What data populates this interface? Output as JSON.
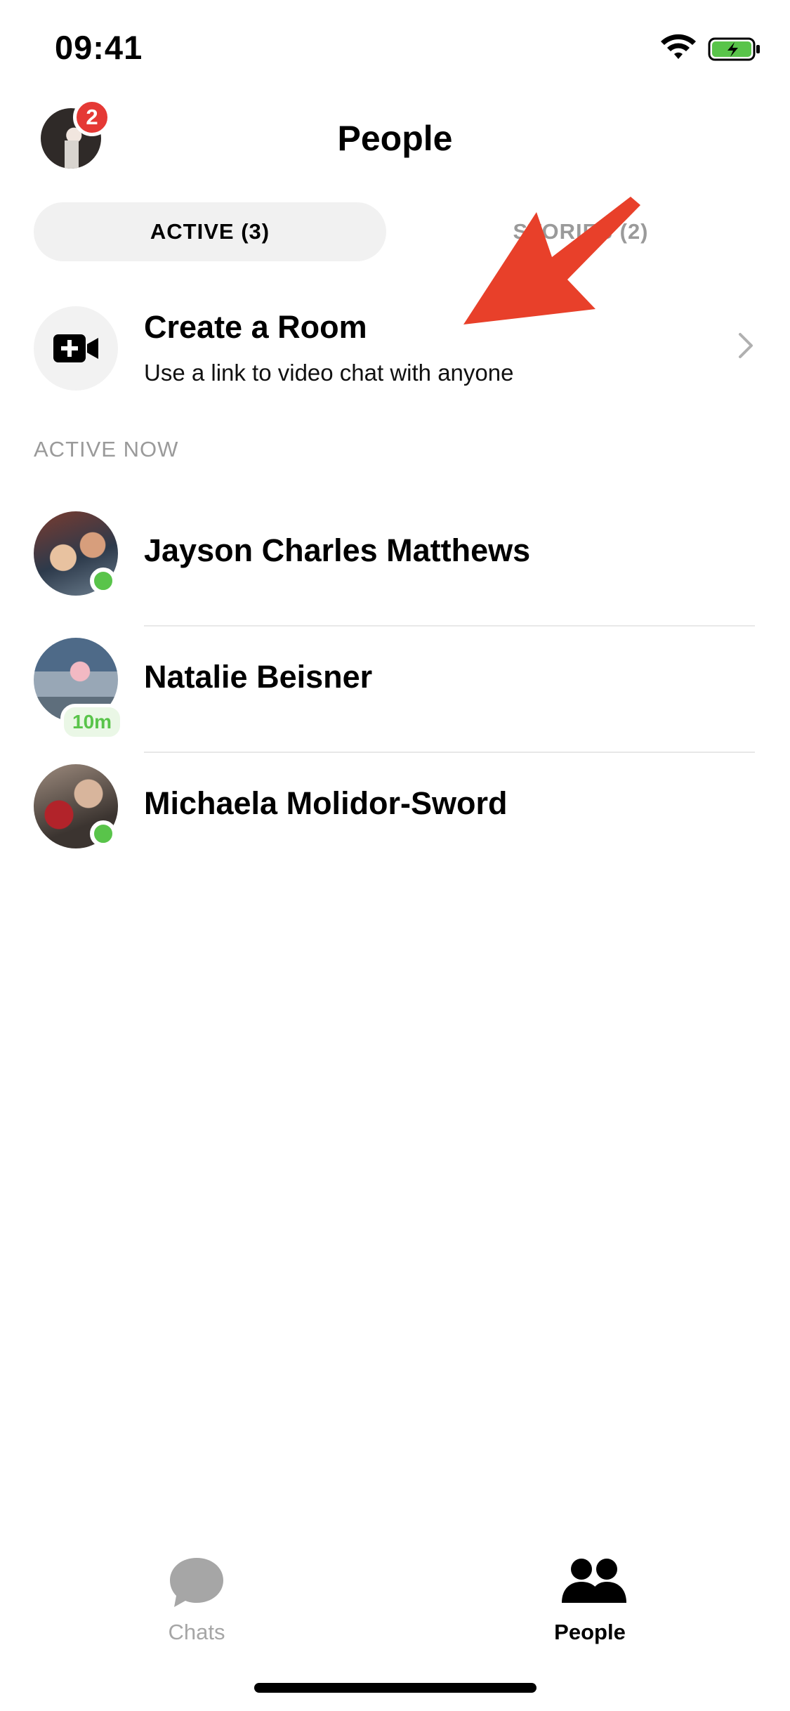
{
  "status_bar": {
    "time": "09:41"
  },
  "header": {
    "title": "People",
    "notification_count": "2"
  },
  "tabs": {
    "active_label": "ACTIVE (3)",
    "stories_label": "STORIES (2)"
  },
  "room": {
    "title": "Create a Room",
    "subtitle": "Use a link to video chat with anyone"
  },
  "section": {
    "label": "ACTIVE NOW"
  },
  "people": [
    {
      "name": "Jayson Charles Matthews",
      "status": "online"
    },
    {
      "name": "Natalie Beisner",
      "status": "10m"
    },
    {
      "name": "Michaela Molidor-Sword",
      "status": "online"
    }
  ],
  "tab_bar": {
    "chats_label": "Chats",
    "people_label": "People"
  },
  "colors": {
    "online": "#59c44a",
    "badge": "#e53935",
    "arrow": "#e8402a",
    "muted": "#9a9a9a"
  },
  "icons": [
    "wifi-icon",
    "battery-icon",
    "video-plus-icon",
    "chevron-right-icon",
    "chat-bubble-icon",
    "people-icon",
    "arrow-annotation"
  ]
}
